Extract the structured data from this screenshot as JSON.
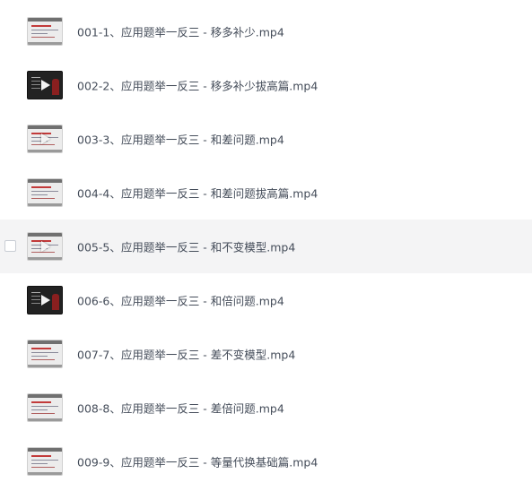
{
  "files": [
    {
      "name": "001-1、应用题举一反三 - 移多补少.mp4",
      "thumbnail": "slide",
      "play_icon": false
    },
    {
      "name": "002-2、应用题举一反三 - 移多补少拔高篇.mp4",
      "thumbnail": "dark",
      "play_icon": true
    },
    {
      "name": "003-3、应用题举一反三 - 和差问题.mp4",
      "thumbnail": "slide",
      "play_icon": true
    },
    {
      "name": "004-4、应用题举一反三 - 和差问题拔高篇.mp4",
      "thumbnail": "slide",
      "play_icon": false
    },
    {
      "name": "005-5、应用题举一反三 - 和不变模型.mp4",
      "thumbnail": "slide",
      "play_icon": true,
      "hovered": true
    },
    {
      "name": "006-6、应用题举一反三 - 和倍问题.mp4",
      "thumbnail": "dark",
      "play_icon": true
    },
    {
      "name": "007-7、应用题举一反三 - 差不变模型.mp4",
      "thumbnail": "slide",
      "play_icon": false
    },
    {
      "name": "008-8、应用题举一反三 - 差倍问题.mp4",
      "thumbnail": "slide",
      "play_icon": false
    },
    {
      "name": "009-9、应用题举一反三 - 等量代换基础篇.mp4",
      "thumbnail": "slide",
      "play_icon": false
    }
  ],
  "colors": {
    "hover_row": "#f4f4f5",
    "file_text": "#454d5a"
  },
  "icons": {
    "play": "play-icon",
    "checkbox": "checkbox-icon"
  }
}
